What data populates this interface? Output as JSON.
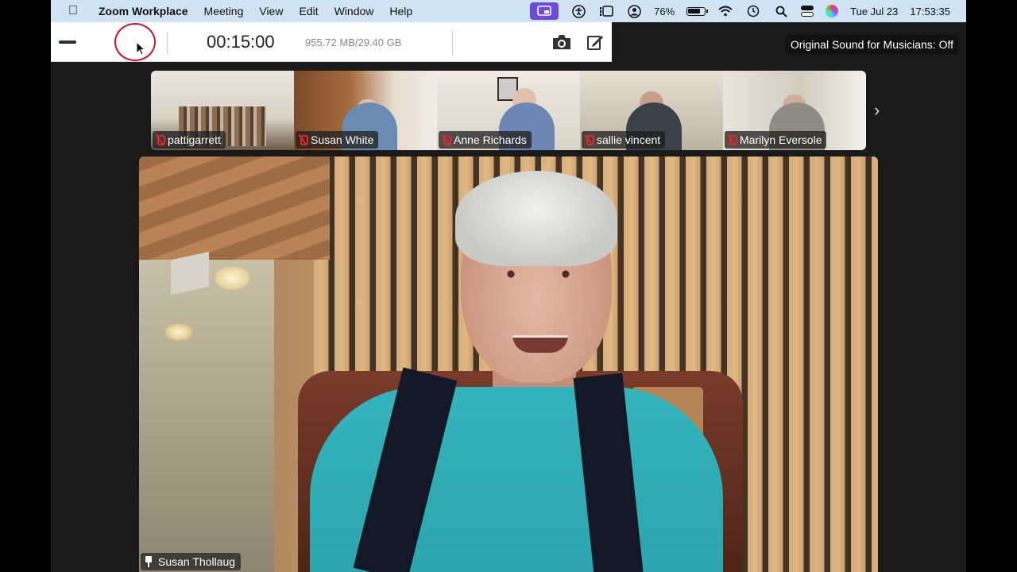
{
  "menubar": {
    "app_name": "Zoom Workplace",
    "menus": [
      "Meeting",
      "View",
      "Edit",
      "Window",
      "Help"
    ],
    "battery": "76%",
    "date": "Tue Jul 23",
    "time": "17:53:35"
  },
  "recorder": {
    "elapsed": "00:15:00",
    "storage": "955.72 MB/29.40 GB"
  },
  "meeting": {
    "original_sound": "Original Sound for Musicians: Off",
    "thumbnails": [
      {
        "name": "pattigarrett",
        "muted": true
      },
      {
        "name": "Susan White",
        "muted": true
      },
      {
        "name": "Anne Richards",
        "muted": true
      },
      {
        "name": "sallie vincent",
        "muted": true
      },
      {
        "name": "Marilyn Eversole",
        "muted": true
      }
    ],
    "active_speaker": {
      "name": "Susan Thollaug",
      "pinned": true
    }
  },
  "colors": {
    "menubar_bg": "#cfe3f3",
    "record_ring": "#c8102e",
    "muted_mic": "#e0272e",
    "screen_share_icon_bg": "#6b4bd8"
  }
}
